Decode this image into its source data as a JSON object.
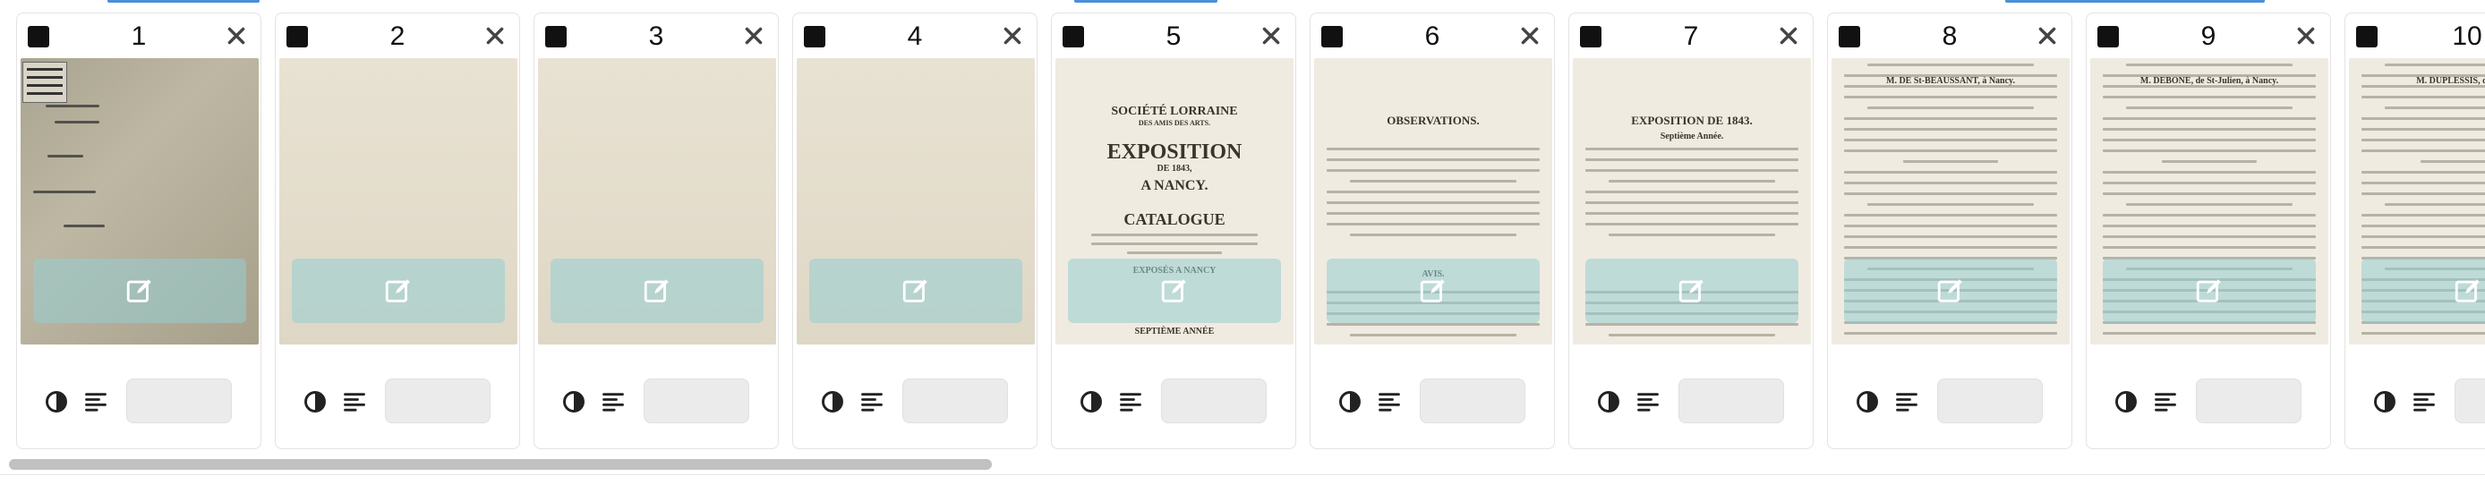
{
  "pages": [
    {
      "number": "1",
      "kind": "cover",
      "cover_lines": [
        "Lorraine",
        "des Amis des A.-A.",
        "Exposition de 1843",
        "Catalogue"
      ],
      "stamp_text": "SOCIETE LORRAINE"
    },
    {
      "number": "2",
      "kind": "blank"
    },
    {
      "number": "3",
      "kind": "blank"
    },
    {
      "number": "4",
      "kind": "blank"
    },
    {
      "number": "5",
      "kind": "title",
      "heading_1": "SOCIÉTÉ LORRAINE",
      "heading_2": "DES AMIS DES ARTS.",
      "heading_3": "EXPOSITION",
      "heading_4": "DE 1843,",
      "heading_5": "A NANCY.",
      "heading_6": "CATALOGUE",
      "footer_1": "EXPOSÉS A NANCY",
      "footer_2": "SEPTIÈME ANNÉE"
    },
    {
      "number": "6",
      "kind": "text",
      "heading": "OBSERVATIONS.",
      "heading_2": "AVIS."
    },
    {
      "number": "7",
      "kind": "text",
      "heading": "EXPOSITION DE 1843.",
      "heading_2": "Septième Année."
    },
    {
      "number": "8",
      "kind": "list",
      "heading": "M. DE St-BEAUSSANT, à Nancy."
    },
    {
      "number": "9",
      "kind": "list",
      "heading": "M. DEBONE, de St-Julien, à Nancy."
    },
    {
      "number": "10",
      "kind": "list",
      "heading": "M. DUPLESSIS, de Nancy."
    }
  ],
  "colors": {
    "overlay": "#96cdd2",
    "checkbox": "#111111",
    "scroll_thumb": "#c1c1c1",
    "accent": "#4a90d9"
  },
  "icons": {
    "checkbox": "checkbox-icon",
    "close": "close-icon",
    "edit": "edit-icon",
    "contrast": "contrast-icon",
    "text": "text-lines-icon"
  },
  "scroll": {
    "position_fraction": 0.0,
    "visible_fraction": 0.4
  }
}
